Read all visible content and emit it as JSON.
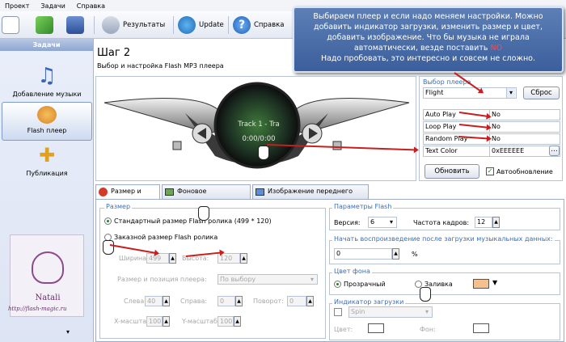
{
  "menu": [
    "Проект",
    "Задачи",
    "Справка"
  ],
  "toolbar": {
    "results": "Результаты",
    "update": "Update",
    "help": "Справка"
  },
  "sidebar": {
    "title": "Задачи",
    "items": [
      {
        "label": "Добавление музыки",
        "icon": "music-note-icon"
      },
      {
        "label": "Flash плеер",
        "icon": "palette-icon"
      },
      {
        "label": "Публикация",
        "icon": "publish-icon"
      }
    ],
    "watermark_text": "Natali",
    "watermark_url": "http://flash-magic.ru"
  },
  "callout": {
    "text_before": "Выбираем плеер и если надо меняем настройки. Можно добавить индикатор загрузки, изменить размер и цвет, добавить изображение. Что бы музыка не играла автоматически, везде поставить ",
    "highlight": "NO",
    "text_after": "Надо  пробовать, это  интересно и совсем не сложно."
  },
  "step": {
    "title": "Шаг 2",
    "subtitle": "Выбор и настройка Flash MP3 плеера"
  },
  "preview": {
    "track": "Track 1 - Tra",
    "time": "0:00/0:00"
  },
  "player_panel": {
    "label": "Выбор плеера",
    "selected": "Flight",
    "reset": "Сброс",
    "props": [
      {
        "key": "Auto Play",
        "value": "No"
      },
      {
        "key": "Loop Play",
        "value": "No"
      },
      {
        "key": "Random Play",
        "value": "No"
      },
      {
        "key": "Text Color",
        "value": "0xEEEEEE"
      }
    ],
    "refresh": "Обновить",
    "autorefresh": "Автообновление"
  },
  "tabs": [
    "Размер и цвет",
    "Фоновое изображение",
    "Изображение переднего плана"
  ],
  "size": {
    "title": "Размер",
    "standard": "Стандартный размер Flash ролика (499 * 120)",
    "custom": "Заказной размер Flash ролика",
    "width_label": "Ширина:",
    "width": "499",
    "height_label": "Высота:",
    "height": "120",
    "position_label": "Размер и позиция плеера:",
    "position_value": "По выбору",
    "left_label": "Слева:",
    "left": "40",
    "right_label": "Справа:",
    "right": "0",
    "rotate_label": "Поворот:",
    "rotate": "0",
    "xscale_label": "X-масштаб",
    "xscale": "100",
    "yscale_label": "Y-масштаб",
    "yscale": "100"
  },
  "flash": {
    "title": "Параметры Flash",
    "version_label": "Версия:",
    "version": "6",
    "fps_label": "Частота кадров:",
    "fps": "12"
  },
  "start": {
    "title": "Начать воспроизведение после загрузки музыкальных данных:",
    "value": "0",
    "unit": "%"
  },
  "bg": {
    "title": "Цвет фона",
    "transparent": "Прозрачный",
    "fill": "Заливка",
    "fill_color": "#f5c08e"
  },
  "indicator": {
    "title": "Индикатор загрузки",
    "type": "Spin",
    "color_label": "Цвет:",
    "bg_label": "Фон:"
  },
  "colors": {
    "accent": "#3a6fb8",
    "arrow": "#c71f1f"
  }
}
